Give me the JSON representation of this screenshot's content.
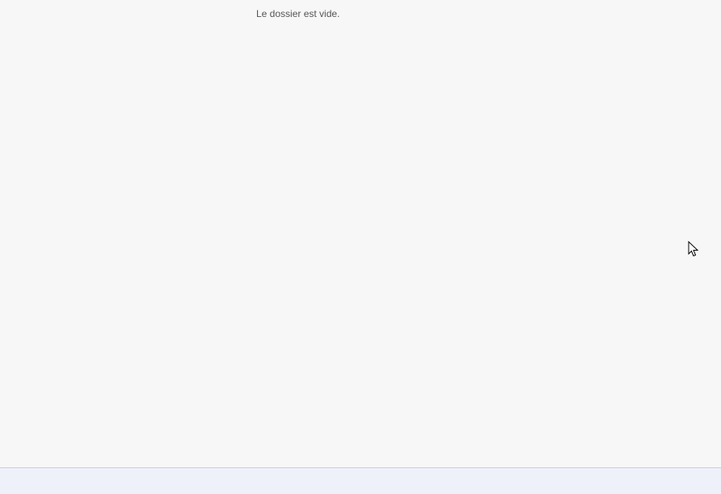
{
  "content": {
    "empty_message": "Le dossier est vide."
  },
  "colors": {
    "background": "#f7f7f7",
    "status_bar": "#eef1fa",
    "status_bar_border": "#c9d0de",
    "text": "#555555"
  },
  "icons": {
    "cursor": "mouse-pointer-icon"
  }
}
